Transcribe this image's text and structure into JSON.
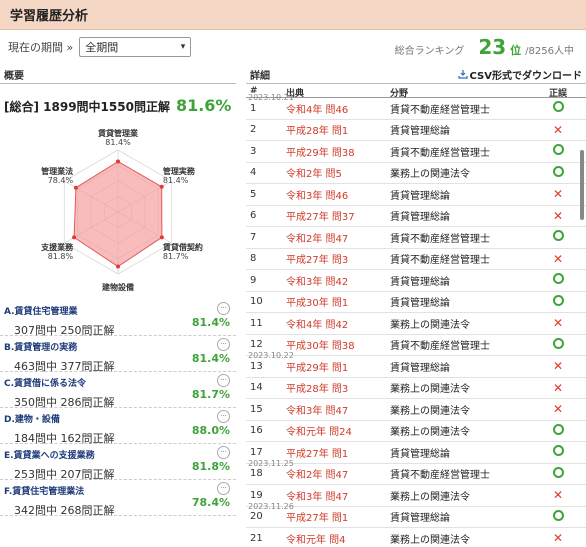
{
  "header": {
    "title": "学習履歴分析"
  },
  "period": {
    "label": "現在の期間 »",
    "selected": "全期間"
  },
  "ranking": {
    "label": "総合ランキング",
    "rank": "23",
    "unit": "位",
    "total": "/8256人中"
  },
  "overview": {
    "title": "概要",
    "overall_text": "[総合] 1899問中1550問正解",
    "overall_pct": "81.6%",
    "radar": [
      {
        "name": "賃貸管理業",
        "pct": "81.4%",
        "value": 81.4
      },
      {
        "name": "管理実務",
        "pct": "81.4%",
        "value": 81.4
      },
      {
        "name": "賃貸借契約",
        "pct": "81.7%",
        "value": 81.7
      },
      {
        "name": "建物設備",
        "pct": "88.0%",
        "value": 88.0
      },
      {
        "name": "支援業務",
        "pct": "81.8%",
        "value": 81.8
      },
      {
        "name": "管理業法",
        "pct": "78.4%",
        "value": 78.4
      }
    ],
    "categories": [
      {
        "name": "A.賃貸住宅管理業",
        "count": "307問中 250問正解",
        "pct": "81.4%"
      },
      {
        "name": "B.賃貸管理の実務",
        "count": "463問中 377問正解",
        "pct": "81.4%"
      },
      {
        "name": "C.賃貸借に係る法令",
        "count": "350問中 286問正解",
        "pct": "81.7%"
      },
      {
        "name": "D.建物・設備",
        "count": "184問中 162問正解",
        "pct": "88.0%"
      },
      {
        "name": "E.賃貸業への支援業務",
        "count": "253問中 207問正解",
        "pct": "81.8%"
      },
      {
        "name": "F.賃貸住宅管理業法",
        "count": "342問中 268問正解",
        "pct": "78.4%"
      }
    ],
    "more_glyph": "···"
  },
  "detail": {
    "title": "詳細",
    "csv_label": "CSV形式でダウンロード",
    "columns": {
      "num": "#",
      "source": "出典",
      "field": "分野",
      "result": "正誤"
    },
    "rows": [
      {
        "date": "2023.10.21",
        "num": "1",
        "source": "令和4年 問46",
        "field": "賃貸不動産経営管理士",
        "ok": true
      },
      {
        "date": "",
        "num": "2",
        "source": "平成28年 問1",
        "field": "賃貸管理総論",
        "ok": false
      },
      {
        "date": "",
        "num": "3",
        "source": "平成29年 問38",
        "field": "賃貸不動産経営管理士",
        "ok": true
      },
      {
        "date": "",
        "num": "4",
        "source": "令和2年 問5",
        "field": "業務上の関連法令",
        "ok": true
      },
      {
        "date": "",
        "num": "5",
        "source": "令和3年 問46",
        "field": "賃貸管理総論",
        "ok": false
      },
      {
        "date": "",
        "num": "6",
        "source": "平成27年 問37",
        "field": "賃貸管理総論",
        "ok": false
      },
      {
        "date": "",
        "num": "7",
        "source": "令和2年 問47",
        "field": "賃貸不動産経営管理士",
        "ok": true
      },
      {
        "date": "",
        "num": "8",
        "source": "平成27年 問3",
        "field": "賃貸不動産経営管理士",
        "ok": false
      },
      {
        "date": "",
        "num": "9",
        "source": "令和3年 問42",
        "field": "賃貸管理総論",
        "ok": true
      },
      {
        "date": "",
        "num": "10",
        "source": "平成30年 問1",
        "field": "賃貸管理総論",
        "ok": true
      },
      {
        "date": "",
        "num": "11",
        "source": "令和4年 問42",
        "field": "業務上の関連法令",
        "ok": false
      },
      {
        "date": "",
        "num": "12",
        "source": "平成30年 問38",
        "field": "賃貸不動産経営管理士",
        "ok": true
      },
      {
        "date": "2023.10.22",
        "num": "13",
        "source": "平成29年 問1",
        "field": "賃貸管理総論",
        "ok": false
      },
      {
        "date": "",
        "num": "14",
        "source": "平成28年 問3",
        "field": "業務上の関連法令",
        "ok": false
      },
      {
        "date": "",
        "num": "15",
        "source": "令和3年 問47",
        "field": "業務上の関連法令",
        "ok": false
      },
      {
        "date": "",
        "num": "16",
        "source": "令和元年 問24",
        "field": "業務上の関連法令",
        "ok": true
      },
      {
        "date": "",
        "num": "17",
        "source": "平成27年 問1",
        "field": "賃貸管理総論",
        "ok": true
      },
      {
        "date": "2023.11.25",
        "num": "18",
        "source": "令和2年 問47",
        "field": "賃貸不動産経営管理士",
        "ok": true
      },
      {
        "date": "",
        "num": "19",
        "source": "令和3年 問47",
        "field": "業務上の関連法令",
        "ok": false
      },
      {
        "date": "2023.11.26",
        "num": "20",
        "source": "平成27年 問1",
        "field": "賃貸管理総論",
        "ok": true
      },
      {
        "date": "",
        "num": "21",
        "source": "令和元年 問4",
        "field": "業務上の関連法令",
        "ok": false
      }
    ]
  },
  "colors": {
    "accent_green": "#3fa33a",
    "error_red": "#e03a2a",
    "header_bg": "#f4d6c4",
    "radar_fill": "#f5a0a0"
  },
  "icons": {
    "select": "chevron-down-icon",
    "csv": "download-icon",
    "more": "more-icon",
    "ok": "circle-icon",
    "ng": "cross-icon"
  }
}
